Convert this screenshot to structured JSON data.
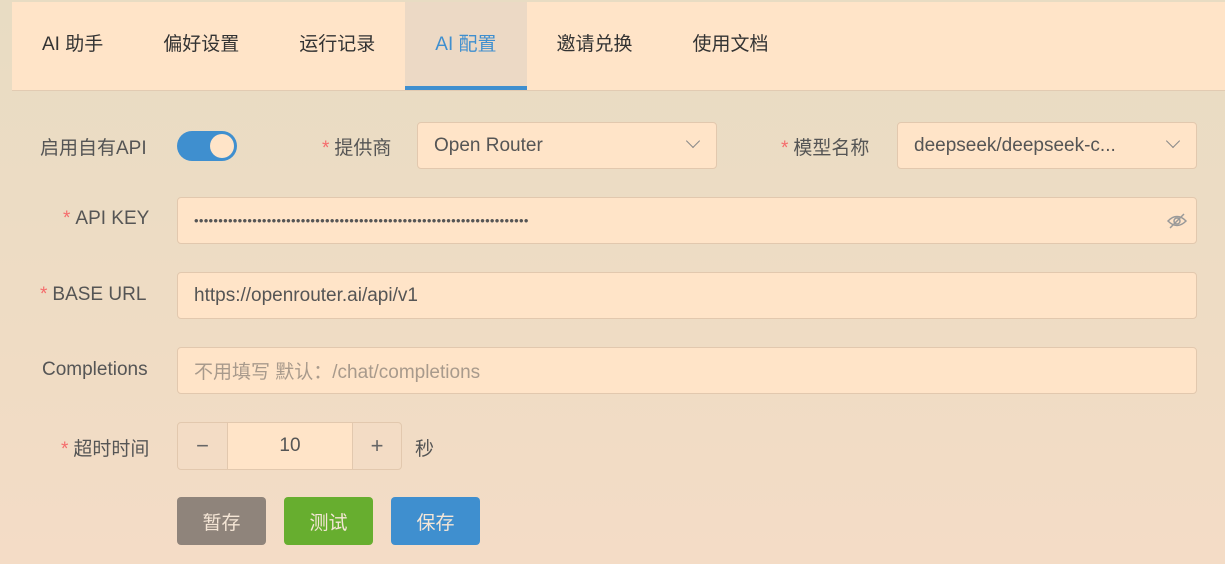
{
  "tabs": [
    {
      "label": "AI 助手"
    },
    {
      "label": "偏好设置"
    },
    {
      "label": "运行记录"
    },
    {
      "label": "AI 配置",
      "active": true
    },
    {
      "label": "邀请兑换"
    },
    {
      "label": "使用文档"
    }
  ],
  "form": {
    "enable_label": "启用自有API",
    "enable_on": true,
    "provider_label": "提供商",
    "provider_value": "Open Router",
    "model_label": "模型名称",
    "model_value": "deepseek/deepseek-c...",
    "apikey_label": "API KEY",
    "apikey_value": "•••••••••••••••••••••••••••••••••••••••••••••••••••••••••••••••••••••",
    "baseurl_label": "BASE URL",
    "baseurl_value": "https://openrouter.ai/api/v1",
    "completions_label": "Completions",
    "completions_placeholder": "不用填写 默认：/chat/completions",
    "timeout_label": "超时时间",
    "timeout_value": "10",
    "timeout_unit": "秒",
    "required_mark": "*"
  },
  "buttons": {
    "draft": "暂存",
    "test": "测试",
    "save": "保存"
  },
  "colors": {
    "accent": "#3f8fcf",
    "test": "#67ae2f",
    "draft": "#8f847b"
  }
}
